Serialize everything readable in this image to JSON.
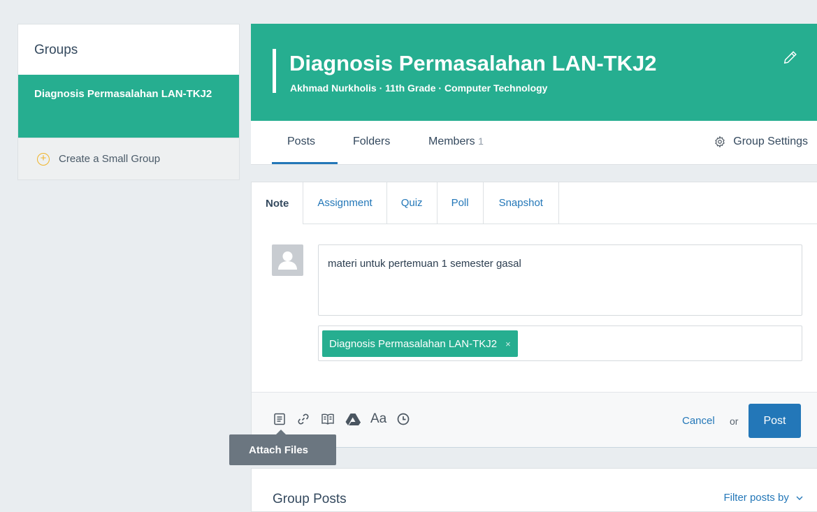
{
  "sidebar": {
    "title": "Groups",
    "active_group": "Diagnosis Permasalahan LAN-TKJ2",
    "create_label": "Create a Small Group"
  },
  "header": {
    "title": "Diagnosis Permasalahan LAN-TKJ2",
    "subtitle": "Akhmad Nurkholis · 11th Grade · Computer Technology"
  },
  "tabs": {
    "posts": "Posts",
    "folders": "Folders",
    "members": "Members",
    "members_count": "1",
    "settings": "Group Settings"
  },
  "composer": {
    "post_types": [
      "Note",
      "Assignment",
      "Quiz",
      "Poll",
      "Snapshot"
    ],
    "note_text": "materi untuk pertemuan 1 semester gasal",
    "recipient": "Diagnosis Permasalahan LAN-TKJ2",
    "remove_glyph": "×",
    "format_label": "Aa",
    "cancel_label": "Cancel",
    "or_label": "or",
    "post_label": "Post",
    "tooltip": "Attach Files"
  },
  "group_posts": {
    "title": "Group Posts",
    "filter_label": "Filter posts by"
  },
  "colors": {
    "brand": "#26ae90",
    "primary": "#2377b8",
    "background": "#e9edf0"
  }
}
